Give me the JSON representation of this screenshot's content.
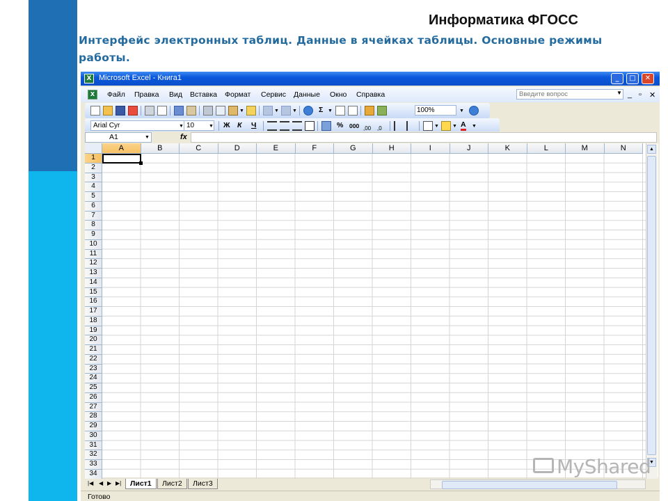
{
  "slide": {
    "title": "Информатика ФГОСС",
    "subtitle": "Интерфейс электронных таблиц. Данные в ячейках таблицы. Основные режимы работы."
  },
  "window": {
    "title": "Microsoft Excel - Книга1",
    "minimize_icon": "minimize-icon",
    "maximize_icon": "maximize-icon",
    "close_icon": "close-icon"
  },
  "menu": {
    "items": [
      "Файл",
      "Правка",
      "Вид",
      "Вставка",
      "Формат",
      "Сервис",
      "Данные",
      "Окно",
      "Справка"
    ],
    "help_placeholder": "Введите вопрос"
  },
  "toolbar": {
    "zoom": "100%",
    "font_name": "Arial Cyr",
    "font_size": "10",
    "bold": "Ж",
    "italic": "К",
    "underline": "Ч",
    "sum": "Σ",
    "percent": "%",
    "thousands": "000",
    "font_color": "A"
  },
  "formula": {
    "name_box": "A1",
    "fx": "fx",
    "value": ""
  },
  "grid": {
    "columns": [
      "A",
      "B",
      "C",
      "D",
      "E",
      "F",
      "G",
      "H",
      "I",
      "J",
      "K",
      "L",
      "M",
      "N"
    ],
    "rows": [
      "1",
      "2",
      "3",
      "4",
      "5",
      "6",
      "7",
      "8",
      "9",
      "10",
      "11",
      "12",
      "13",
      "14",
      "15",
      "16",
      "17",
      "18",
      "19",
      "20",
      "21",
      "22",
      "23",
      "24",
      "25",
      "26",
      "27",
      "28",
      "29",
      "30",
      "31",
      "32",
      "33",
      "34"
    ],
    "active_cell": "A1"
  },
  "sheets": {
    "tabs": [
      "Лист1",
      "Лист2",
      "Лист3"
    ],
    "active": "Лист1"
  },
  "status": {
    "text": "Готово"
  },
  "watermark": "MyShared",
  "colors": {
    "sidebar_dark": "#1f6fb4",
    "sidebar_light": "#0fb6ee",
    "subtitle": "#236a9f",
    "title_bar": "#0a58dd"
  }
}
